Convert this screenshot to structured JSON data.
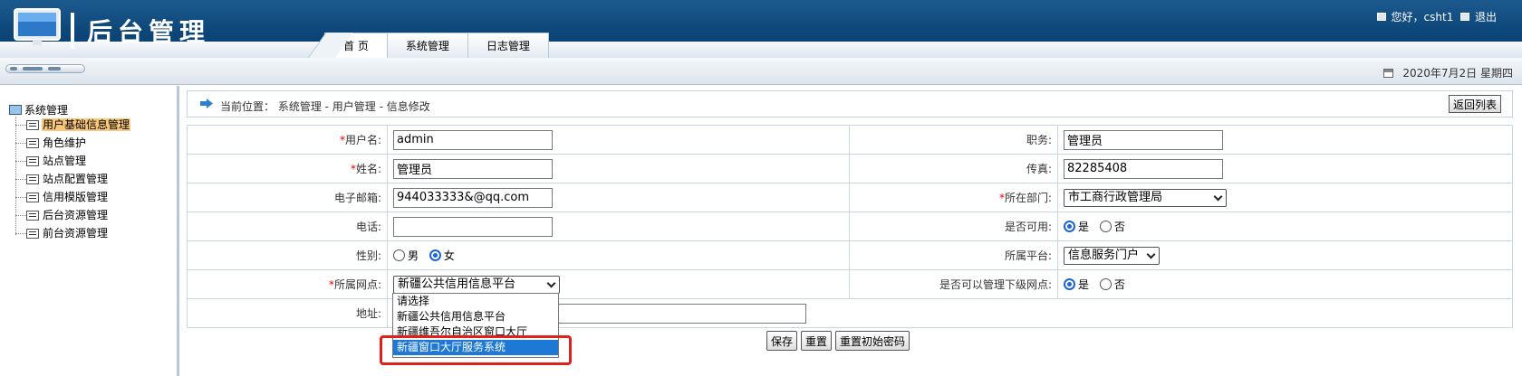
{
  "header": {
    "title": "后台管理",
    "greeting": "您好，csht1",
    "logout_label": "退出",
    "nav_tabs": [
      {
        "label": "首 页",
        "active": true
      },
      {
        "label": "系统管理",
        "active": false
      },
      {
        "label": "日志管理",
        "active": false
      }
    ]
  },
  "toolbar": {
    "date": "2020年7月2日 星期四"
  },
  "sidebar": {
    "root_label": "系统管理",
    "items": [
      {
        "label": "用户基础信息管理",
        "selected": true
      },
      {
        "label": "角色维护",
        "selected": false
      },
      {
        "label": "站点管理",
        "selected": false
      },
      {
        "label": "站点配置管理",
        "selected": false
      },
      {
        "label": "信用模版管理",
        "selected": false
      },
      {
        "label": "后台资源管理",
        "selected": false
      },
      {
        "label": "前台资源管理",
        "selected": false
      }
    ]
  },
  "breadcrumb": {
    "text": "当前位置：  系统管理 - 用户管理 - 信息修改",
    "back_label": "返回列表"
  },
  "form": {
    "username": {
      "label": "用户名:",
      "value": "admin"
    },
    "position": {
      "label": "职务:",
      "value": "管理员"
    },
    "realname": {
      "label": "姓名:",
      "value": "管理员"
    },
    "fax": {
      "label": "传真:",
      "value": "82285408"
    },
    "email": {
      "label": "电子邮箱:",
      "value": "944033333&@qq.com"
    },
    "department": {
      "label": "所在部门:",
      "value": "市工商行政管理局"
    },
    "phone": {
      "label": "电话:",
      "value": ""
    },
    "enabled": {
      "label": "是否可用:",
      "options": [
        "是",
        "否"
      ],
      "selected": "是"
    },
    "gender": {
      "label": "性别:",
      "options": [
        "男",
        "女"
      ],
      "selected": "女"
    },
    "platform": {
      "label": "所属平台:",
      "value": "信息服务门户"
    },
    "site": {
      "label": "所属网点:",
      "value": "新疆公共信用信息平台",
      "options": [
        "请选择",
        "新疆公共信用信息平台",
        "新疆维吾尔自治区窗口大厅",
        "新疆窗口大厅服务系统"
      ],
      "highlighted": "新疆窗口大厅服务系统"
    },
    "manage_sub": {
      "label": "是否可以管理下级网点:",
      "options": [
        "是",
        "否"
      ],
      "selected": "是"
    },
    "address": {
      "label": "地址:",
      "value": ""
    }
  },
  "actions": {
    "save": "保存",
    "reset": "重置",
    "reset_password": "重置初始密码"
  },
  "colors": {
    "header_bg": "#0d4679",
    "selected_item_bg": "#f8c77a",
    "highlight_box": "#e0211b",
    "option_highlight": "#1e78d6"
  },
  "icons": [
    "logo-monitor-icon",
    "mail-icon",
    "logout-icon",
    "calendar-icon",
    "computer-icon",
    "document-icon",
    "arrow-right-icon",
    "chevron-down-icon"
  ]
}
